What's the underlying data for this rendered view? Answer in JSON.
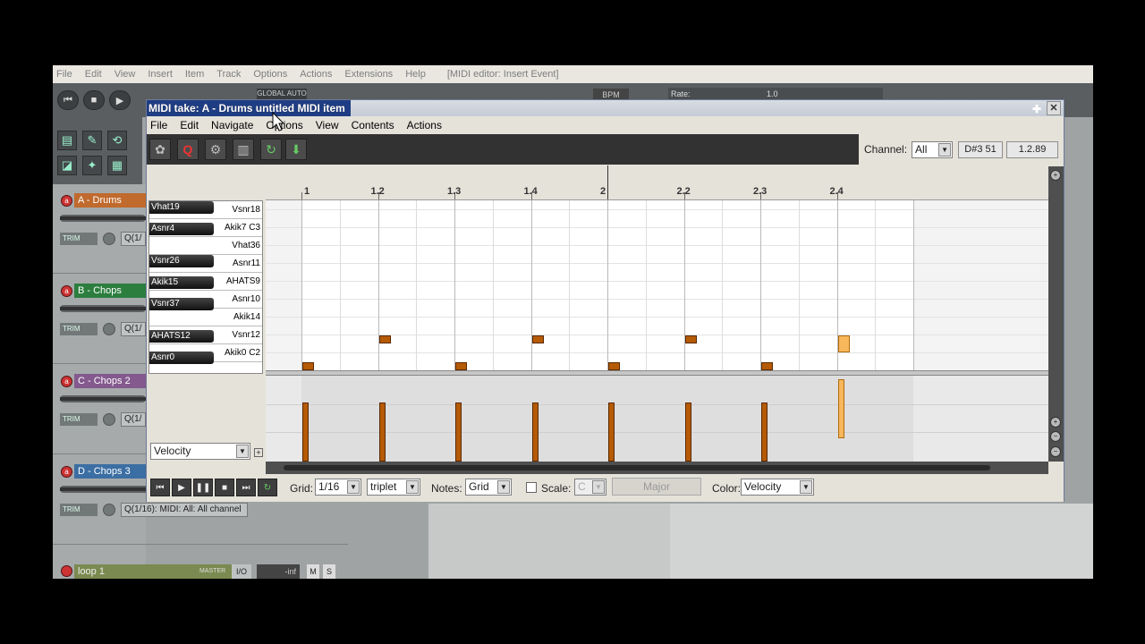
{
  "main_menu": {
    "items": [
      "File",
      "Edit",
      "View",
      "Insert",
      "Item",
      "Track",
      "Options",
      "Actions",
      "Extensions",
      "Help"
    ],
    "title": "[MIDI editor: Insert Event]"
  },
  "transport": {
    "global_auto": "GLOBAL AUTO",
    "bpm_label": "BPM",
    "rate_label": "Rate:",
    "rate_value": "1.0"
  },
  "tracks": [
    {
      "name": "A - Drums",
      "color": "#c06a2d",
      "q": "Q(1/"
    },
    {
      "name": "B - Chops",
      "color": "#2c7e3f",
      "q": "Q(1/"
    },
    {
      "name": "C - Chops 2",
      "color": "#84598e",
      "q": "Q(1/"
    },
    {
      "name": "D - Chops 3",
      "color": "#3b6ea3",
      "q": "Q(1/16): MIDI: All: All channel"
    }
  ],
  "track_labels": {
    "trim": "TRIM"
  },
  "bottom_track": {
    "name": "loop 1",
    "master": "MASTER",
    "io": "I/O",
    "vol": "-inf",
    "m": "M",
    "s": "S"
  },
  "midi_editor": {
    "title": "MIDI take: A - Drums untitled MIDI item",
    "menu": [
      "File",
      "Edit",
      "Navigate",
      "Options",
      "View",
      "Contents",
      "Actions"
    ],
    "channel_label": "Channel:",
    "channel_value": "All",
    "note_readout": "D#3  51",
    "pos_readout": "1.2.89",
    "ruler": [
      "1",
      "1.2",
      "1.3",
      "1.4",
      "2",
      "2.2",
      "2.3",
      "2.4"
    ],
    "keys_white": [
      "Vsnr18",
      "Akik7  C3",
      "Vhat36",
      "Asnr11",
      "AHATS9",
      "Asnr10",
      "Akik14",
      "Vsnr12",
      "Akik0  C2"
    ],
    "keys_black": [
      "Vhat19",
      "Asnr4",
      "Vsnr26",
      "Akik15",
      "Vsnr37",
      "AHATS12",
      "Asnr0"
    ],
    "lane_select": "Velocity",
    "notes": [
      {
        "pos": 0.0,
        "row": 9,
        "vel": 0.92,
        "selected": false
      },
      {
        "pos": 0.125,
        "row": 8,
        "vel": 0.92,
        "selected": false
      },
      {
        "pos": 0.25,
        "row": 9,
        "vel": 0.92,
        "selected": false
      },
      {
        "pos": 0.375,
        "row": 8,
        "vel": 0.92,
        "selected": false
      },
      {
        "pos": 0.5,
        "row": 9,
        "vel": 0.92,
        "selected": false
      },
      {
        "pos": 0.625,
        "row": 8,
        "vel": 0.92,
        "selected": false
      },
      {
        "pos": 0.75,
        "row": 9,
        "vel": 0.92,
        "selected": false
      },
      {
        "pos": 0.875,
        "row": 8,
        "vel": 0.92,
        "selected": true
      }
    ],
    "bottom": {
      "grid_label": "Grid:",
      "grid_value": "1/16",
      "grid_type": "triplet",
      "notes_label": "Notes:",
      "notes_value": "Grid",
      "scale_label": "Scale:",
      "scale_value": "C",
      "major_label": "Major",
      "color_label": "Color:",
      "color_value": "Velocity"
    }
  },
  "colors": {
    "note": "#b55a05",
    "note_selected": "#f8b75b"
  }
}
